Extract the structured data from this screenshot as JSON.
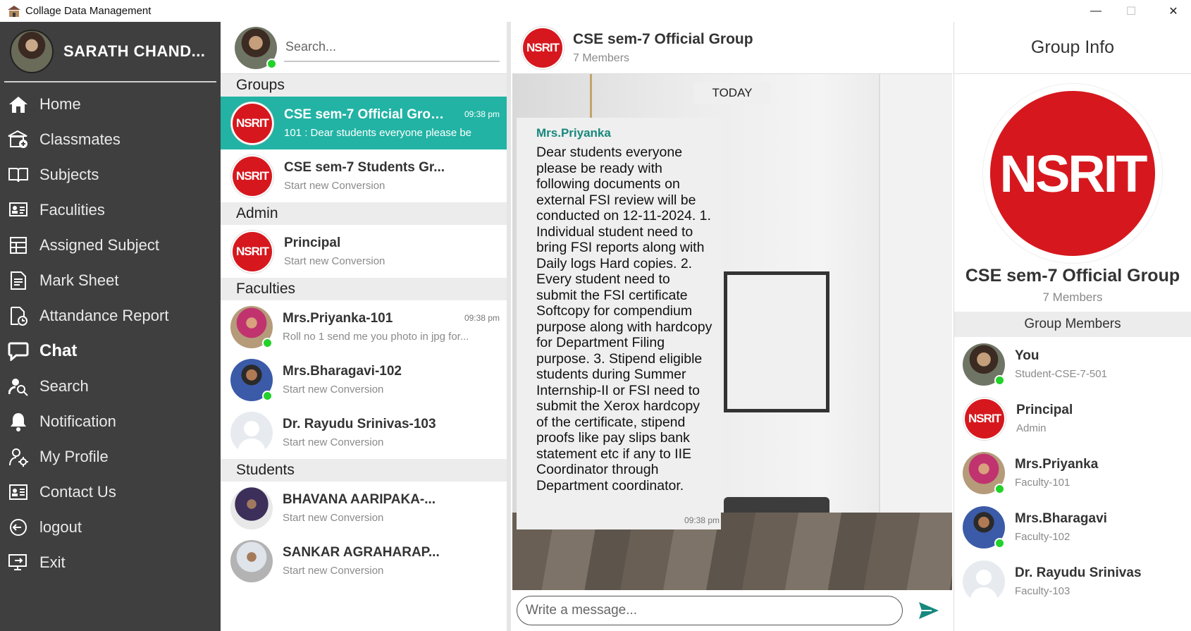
{
  "window": {
    "title": "Collage Data Management",
    "minimize": "—",
    "maximize": "☐",
    "close": "✕"
  },
  "user": {
    "name": "SARATH CHAND..."
  },
  "sidebar": {
    "items": [
      {
        "label": "Home",
        "icon": "home-icon"
      },
      {
        "label": "Classmates",
        "icon": "classmates-icon"
      },
      {
        "label": "Subjects",
        "icon": "book-icon"
      },
      {
        "label": "Faculities",
        "icon": "faculty-icon"
      },
      {
        "label": "Assigned Subject",
        "icon": "assigned-icon"
      },
      {
        "label": "Mark Sheet",
        "icon": "marksheet-icon"
      },
      {
        "label": "Attandance Report",
        "icon": "report-icon"
      },
      {
        "label": "Chat",
        "icon": "chat-icon",
        "active": true
      },
      {
        "label": "Search",
        "icon": "search-user-icon"
      },
      {
        "label": "Notification",
        "icon": "bell-icon"
      },
      {
        "label": "My Profile",
        "icon": "profile-icon"
      },
      {
        "label": "Contact Us",
        "icon": "contact-icon"
      },
      {
        "label": "logout",
        "icon": "logout-icon"
      },
      {
        "label": "Exit",
        "icon": "exit-icon"
      }
    ]
  },
  "list": {
    "search_placeholder": "Search...",
    "sections": {
      "groups": "Groups",
      "admin": "Admin",
      "faculties": "Faculties",
      "students": "Students"
    },
    "groups": [
      {
        "name": "CSE sem-7 Official Group",
        "sub": "101 : Dear students everyone please be",
        "time": "09:38 pm"
      },
      {
        "name": "CSE sem-7 Students Gr...",
        "sub": "Start new Conversion",
        "time": ""
      }
    ],
    "admin": [
      {
        "name": "Principal",
        "sub": "Start new Conversion",
        "time": ""
      }
    ],
    "faculties": [
      {
        "name": "Mrs.Priyanka-101",
        "sub": "Roll no 1 send me you photo in jpg for...",
        "time": "09:38 pm"
      },
      {
        "name": "Mrs.Bharagavi-102",
        "sub": "Start new Conversion",
        "time": ""
      },
      {
        "name": "Dr. Rayudu Srinivas-103",
        "sub": "Start new Conversion",
        "time": ""
      }
    ],
    "students": [
      {
        "name": "BHAVANA AARIPAKA-...",
        "sub": "Start new Conversion"
      },
      {
        "name": "SANKAR AGRAHARAP...",
        "sub": "Start new Conversion"
      }
    ]
  },
  "conversation": {
    "title": "CSE sem-7 Official Group",
    "members": "7 Members",
    "day_label": "TODAY",
    "message": {
      "sender": "Mrs.Priyanka",
      "text": "Dear students everyone please be ready with following documents on external FSI review will be conducted on 12-11-2024. 1. Individual student need to bring FSI reports along with Daily logs Hard copies. 2. Every student need to submit the FSI certificate Softcopy for compendium purpose along with hardcopy for Department Filing purpose. 3. Stipend eligible students during Summer Internship-II or FSI need to submit the Xerox hardcopy of the certificate, stipend proofs like pay slips bank statement etc if any to IIE Coordinator through Department coordinator.",
      "time": "09:38 pm"
    },
    "input_placeholder": "Write a message..."
  },
  "info": {
    "header": "Group Info",
    "logo_text": "NSRIT",
    "group_name": "CSE sem-7 Official Group",
    "members": "7 Members",
    "members_header": "Group Members",
    "list": [
      {
        "name": "You",
        "role": "Student-CSE-7-501"
      },
      {
        "name": "Principal",
        "role": "Admin"
      },
      {
        "name": "Mrs.Priyanka",
        "role": "Faculty-101"
      },
      {
        "name": "Mrs.Bharagavi",
        "role": "Faculty-102"
      },
      {
        "name": "Dr. Rayudu Srinivas",
        "role": "Faculty-103"
      }
    ]
  },
  "colors": {
    "sidebar": "#3f3f3f",
    "selected": "#22b3a4",
    "sender": "#17887d",
    "logo_red": "#d6181e",
    "online": "#22d12a"
  }
}
